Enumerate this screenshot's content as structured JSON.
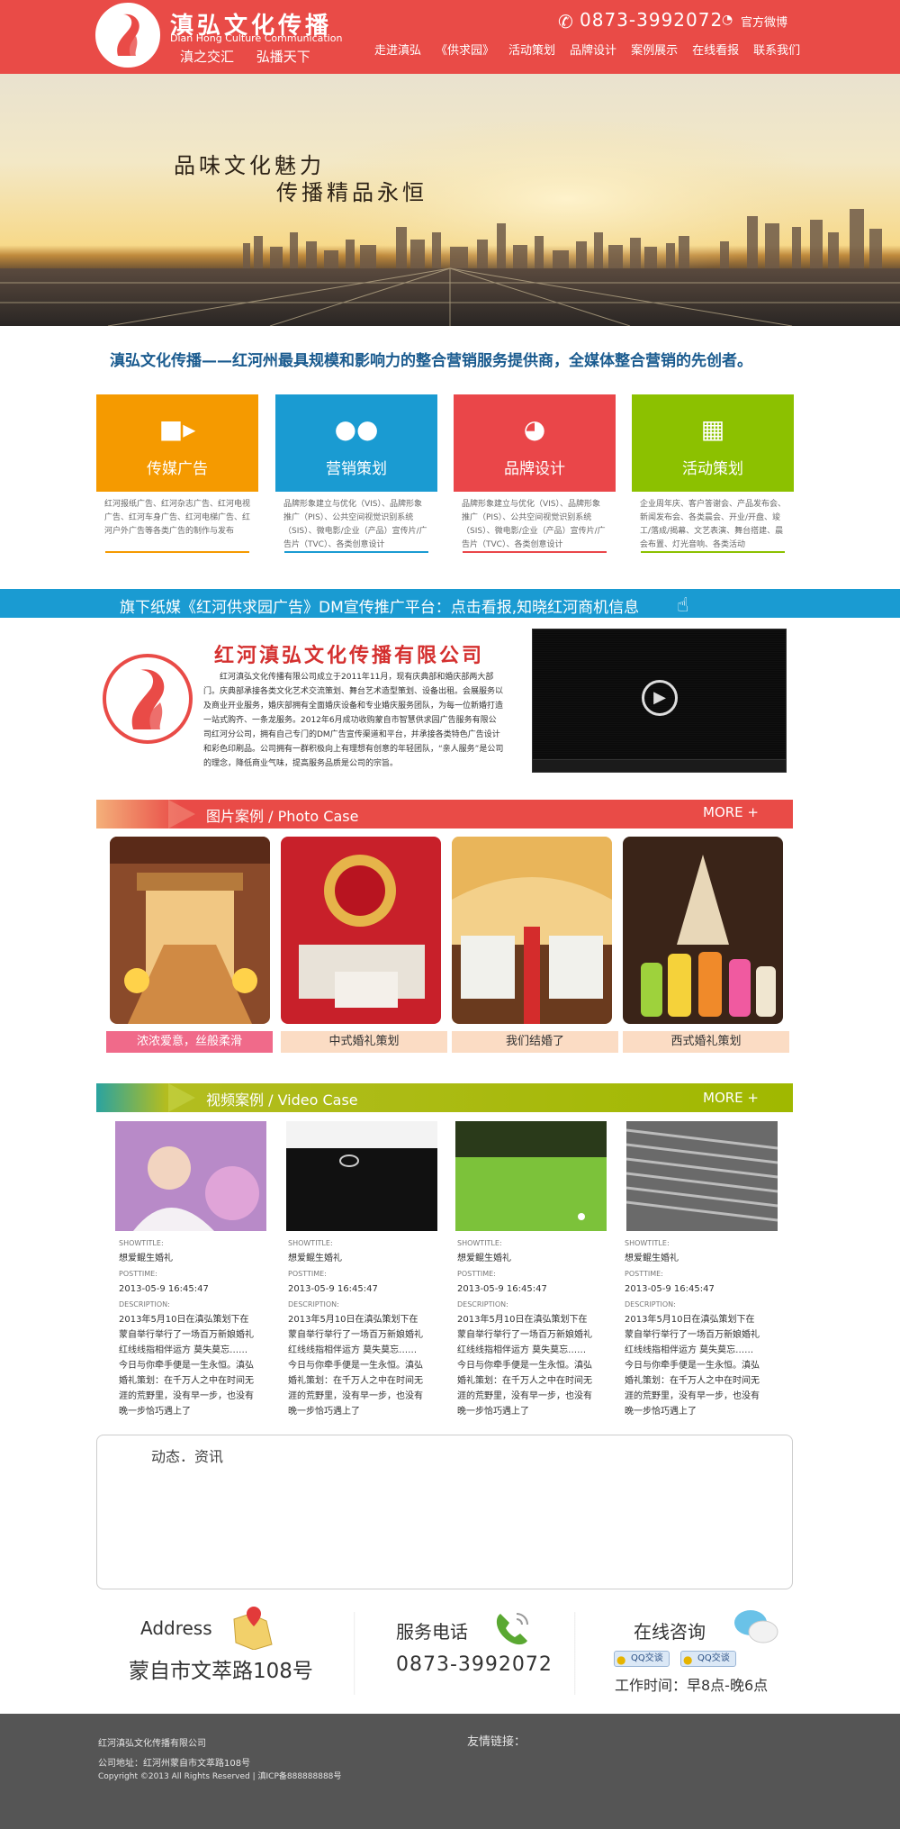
{
  "header": {
    "brand_cn": "滇弘文化传播",
    "brand_en": "Dian Hong Culture Communication",
    "slogan": "滇之交汇 弘播天下",
    "phone": "0873-3992072",
    "weibo": "官方微博",
    "nav": [
      "走进滇弘",
      "《供求园》",
      "活动策划",
      "品牌设计",
      "案例展示",
      "在线看报",
      "联系我们"
    ]
  },
  "banner": {
    "line1": "品味文化魅力",
    "line2": "传播精品永恒"
  },
  "intro": "滇弘文化传播——红河州最具规模和影响力的整合营销服务提供商，全媒体整合营销的先创者。",
  "services": [
    {
      "title": "传媒广告",
      "icon": "video-camera-icon",
      "color": "#f59a00",
      "desc": "红河报纸广告、红河杂志广告、红河电视广告、红河车身广告、红河电梯广告、红河户外广告等各类广告的制作与发布"
    },
    {
      "title": "营销策划",
      "icon": "people-icon",
      "color": "#1a9bd2",
      "desc": "品牌形象建立与优化（VIS）、品牌形象推广（PIS）、公共空间视觉识别系统（SIS）、微电影/企业（产品）宣传片/广告片（TVC）、各类创意设计"
    },
    {
      "title": "品牌设计",
      "icon": "palette-icon",
      "color": "#ea4649",
      "desc": "品牌形象建立与优化（VIS）、品牌形象推广（PIS）、公共空间视觉识别系统（SIS）、微电影/企业（产品）宣传片/广告片（TVC）、各类创意设计"
    },
    {
      "title": "活动策划",
      "icon": "cube-icon",
      "color": "#8cc100",
      "desc": "企业周年庆、客户答谢会、产品发布会、新闻发布会、各类晨会、开业/开盘、竣工/落成/揭幕、文艺表演、舞台搭建、晨会布置、灯光音响、各类活动"
    }
  ],
  "dm_strip": "旗下纸媒《红河供求园广告》DM宣传推广平台：点击看报,知晓红河商机信息",
  "company": {
    "name": "红河滇弘文化传播有限公司",
    "text": "红河滇弘文化传播有限公司成立于2011年11月，现有庆典部和婚庆部两大部门。庆典部承接各类文化艺术交流策划、舞台艺术造型策划、设备出租。会展服务以及商业开业服务，婚庆部拥有全面婚庆设备和专业婚庆服务团队，为每一位新婚打造一站式购齐、一条龙服务。2012年6月成功收购蒙自市智慧供求园广告服务有限公司红河分公司，拥有自己专门的DM广告宣传渠道和平台，并承接各类特色广告设计和彩色印刷品。公司拥有一群积极向上有理想有创意的年轻团队，“亲人服务”是公司的理念，降低商业气味，提高服务品质是公司的宗旨。"
  },
  "photo_section": {
    "title": "图片案例",
    "title_en": "Photo Case",
    "more": "MORE +"
  },
  "photos": [
    "浓浓爱意，丝般柔滑",
    "中式婚礼策划",
    "我们结婚了",
    "西式婚礼策划"
  ],
  "video_section": {
    "title": "视频案例",
    "title_en": "Video Case",
    "more": "MORE +"
  },
  "videos": [
    {
      "showtitle_label": "SHOWTITLE:",
      "title": "想爱鲲生婚礼",
      "posttime_label": "POSTTIME:",
      "posttime": "2013-05-9 16:45:47",
      "desc_label": "DESCRIPTION:",
      "desc": "2013年5月10日在滇弘策划下在蒙自举行举行了一场百万新娘婚礼红线线指相伴运方 莫失莫忘……今日与你牵手便是一生永恒。滇弘婚礼策划：在千万人之中在时间无涯的荒野里，没有早一步，也没有晚一步恰巧遇上了"
    },
    {
      "showtitle_label": "SHOWTITLE:",
      "title": "想爱鲲生婚礼",
      "posttime_label": "POSTTIME:",
      "posttime": "2013-05-9 16:45:47",
      "desc_label": "DESCRIPTION:",
      "desc": "2013年5月10日在滇弘策划下在蒙自举行举行了一场百万新娘婚礼红线线指相伴运方 莫失莫忘……今日与你牵手便是一生永恒。滇弘婚礼策划：在千万人之中在时间无涯的荒野里，没有早一步，也没有晚一步恰巧遇上了"
    },
    {
      "showtitle_label": "SHOWTITLE:",
      "title": "想爱鲲生婚礼",
      "posttime_label": "POSTTIME:",
      "posttime": "2013-05-9 16:45:47",
      "desc_label": "DESCRIPTION:",
      "desc": "2013年5月10日在滇弘策划下在蒙自举行举行了一场百万新娘婚礼红线线指相伴运方 莫失莫忘……今日与你牵手便是一生永恒。滇弘婚礼策划：在千万人之中在时间无涯的荒野里，没有早一步，也没有晚一步恰巧遇上了"
    },
    {
      "showtitle_label": "SHOWTITLE:",
      "title": "想爱鲲生婚礼",
      "posttime_label": "POSTTIME:",
      "posttime": "2013-05-9 16:45:47",
      "desc_label": "DESCRIPTION:",
      "desc": "2013年5月10日在滇弘策划下在蒙自举行举行了一场百万新娘婚礼红线线指相伴运方 莫失莫忘……今日与你牵手便是一生永恒。滇弘婚礼策划：在千万人之中在时间无涯的荒野里，没有早一步，也没有晚一步恰巧遇上了"
    }
  ],
  "news": {
    "title": "动态．资讯"
  },
  "contact": {
    "address_label": "Address",
    "address": "蒙自市文萃路108号",
    "tel_label": "服务电话",
    "tel": "0873-3992072",
    "online_label": "在线咨询",
    "qq1": "QQ交谈",
    "qq2": "QQ交谈",
    "hours": "工作时间：早8点-晚6点"
  },
  "footer": {
    "company": "红河滇弘文化传播有限公司",
    "links_label": "友情链接：",
    "address": "公司地址：红河州蒙自市文萃路108号",
    "copyright": "Copyright ©2013 All Rights Reserved | 滇ICP备888888888号"
  }
}
